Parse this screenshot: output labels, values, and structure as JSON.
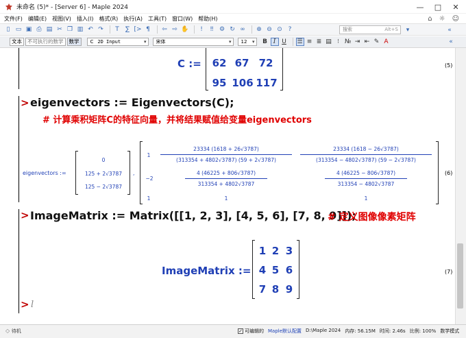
{
  "window": {
    "title": "未命名 (5)* - [Server 6] - Maple 2024",
    "minimize": "—",
    "maximize": "□",
    "close": "✕"
  },
  "menu": {
    "items": [
      "文件(F)",
      "编辑(E)",
      "视图(V)",
      "插入(I)",
      "格式(R)",
      "执行(A)",
      "工具(T)",
      "窗口(W)",
      "帮助(H)"
    ]
  },
  "toolbar": {
    "search_placeholder": "搜索",
    "search_shortcut": "Alt+S"
  },
  "formatbar": {
    "mode_text": "文本",
    "mode_nonexec": "不可执行的数学",
    "mode_math": "数学",
    "style_prefix": "C",
    "style_value": "2D Input",
    "font_value": "宋体",
    "size_value": "12",
    "bold": "B",
    "italic": "I",
    "underline": "U"
  },
  "document": {
    "c_matrix": {
      "lhs": "C :=",
      "rows": [
        [
          "62",
          "67",
          "72"
        ],
        [
          "95",
          "106",
          "117"
        ]
      ],
      "eqno": "(5)"
    },
    "eigen_input": {
      "text": "eigenvectors := Eigenvectors(C);",
      "comment": "# 计算乘积矩阵C的特征向量，并将结果赋值给变量eigenvectors"
    },
    "eigen_output": {
      "lhs": "eigenvectors :=",
      "vec": [
        "0",
        "125 + 2√3787",
        "125 − 2√3787"
      ],
      "mat_row1_col1": "1",
      "mat_row1_col2_num": "23334 (1618 + 26√3787)",
      "mat_row1_col2_den": "(313354 + 4802√3787) (59 + 2√3787)",
      "mat_row1_col3_num": "23334 (1618 − 26√3787)",
      "mat_row1_col3_den": "(313354 − 4802√3787) (59 − 2√3787)",
      "mat_row2_col1": "−2",
      "mat_row2_col2_num": "4 (46225 + 806√3787)",
      "mat_row2_col2_den": "313354 + 4802√3787",
      "mat_row2_col3_num": "4 (46225 − 806√3787)",
      "mat_row2_col3_den": "313354 − 4802√3787",
      "mat_row3": [
        "1",
        "1",
        "1"
      ],
      "eqno": "(6)"
    },
    "image_input": {
      "text": "ImageMatrix := Matrix([[1, 2, 3], [4, 5, 6], [7, 8, 9]]);",
      "comment": "# 定义图像像素矩阵"
    },
    "image_output": {
      "lhs": "ImageMatrix :=",
      "rows": [
        [
          "1",
          "2",
          "3"
        ],
        [
          "4",
          "5",
          "6"
        ],
        [
          "7",
          "8",
          "9"
        ]
      ],
      "eqno": "(7)"
    },
    "empty_prompt": ">",
    "cursor": "l"
  },
  "status": {
    "ready": "待机",
    "editable_label": "可编辑的",
    "settings_link": "Maple默认配置",
    "path": "D:\\Maple 2024",
    "memory": "内存: 56.15M",
    "time": "时间: 2.46s",
    "zoom": "比例: 100%",
    "mode": "数学模式"
  },
  "colors": {
    "prompt": "#c00000",
    "output": "#1f3fb5",
    "comment": "#e00000"
  }
}
